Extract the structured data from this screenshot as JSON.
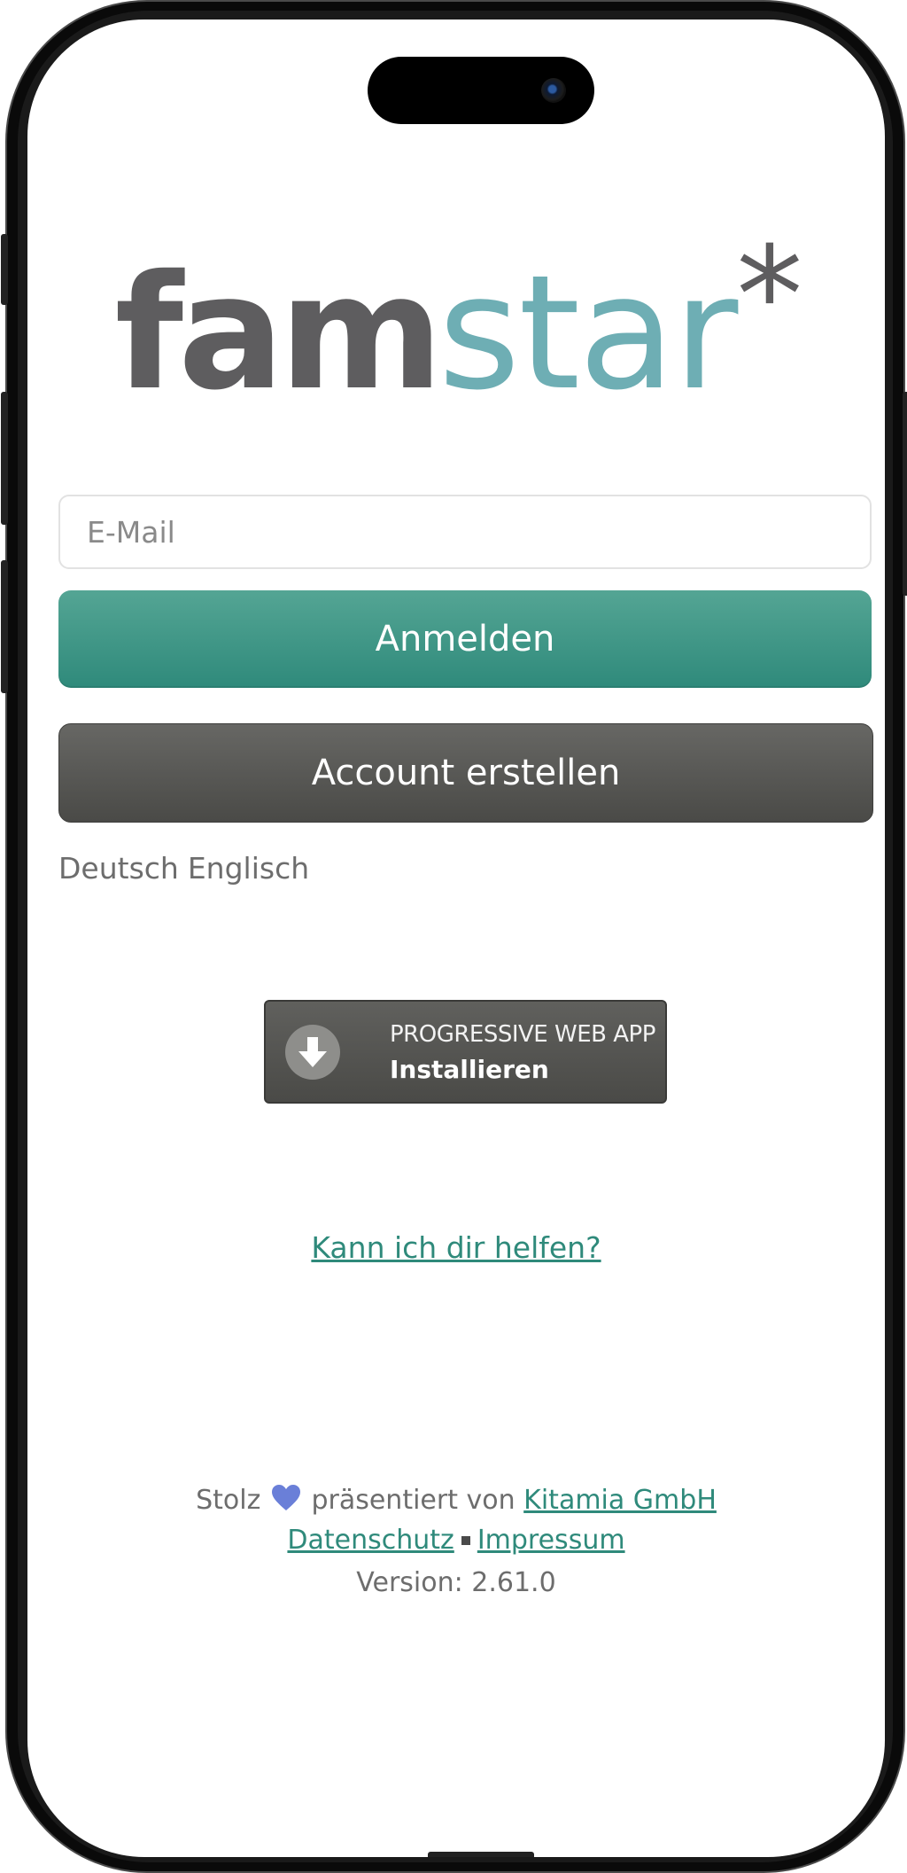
{
  "logo": {
    "part1": "fam",
    "part2": "star",
    "part3": "*",
    "colors": {
      "fam": "#5e5d5f",
      "star": "#6eaeb4"
    }
  },
  "login": {
    "email_placeholder": "E-Mail",
    "email_value": "",
    "login_label": "Anmelden",
    "create_account_label": "Account erstellen"
  },
  "languages": [
    "Deutsch",
    "Englisch"
  ],
  "pwa": {
    "icon": "download-icon",
    "line1": "PROGRESSIVE WEB APP",
    "line2": "Installieren"
  },
  "help_link": "Kann ich dir helfen?",
  "footer": {
    "proud": "Stolz",
    "heart_icon": "heart-icon",
    "presented_by": "präsentiert von",
    "company": "Kitamia GmbH",
    "privacy": "Datenschutz",
    "imprint": "Impressum",
    "version": "Version: 2.61.0"
  },
  "colors": {
    "accent": "#2f8a7b",
    "button_dark": "#4a4a47",
    "heart": "#6a7fd8"
  }
}
